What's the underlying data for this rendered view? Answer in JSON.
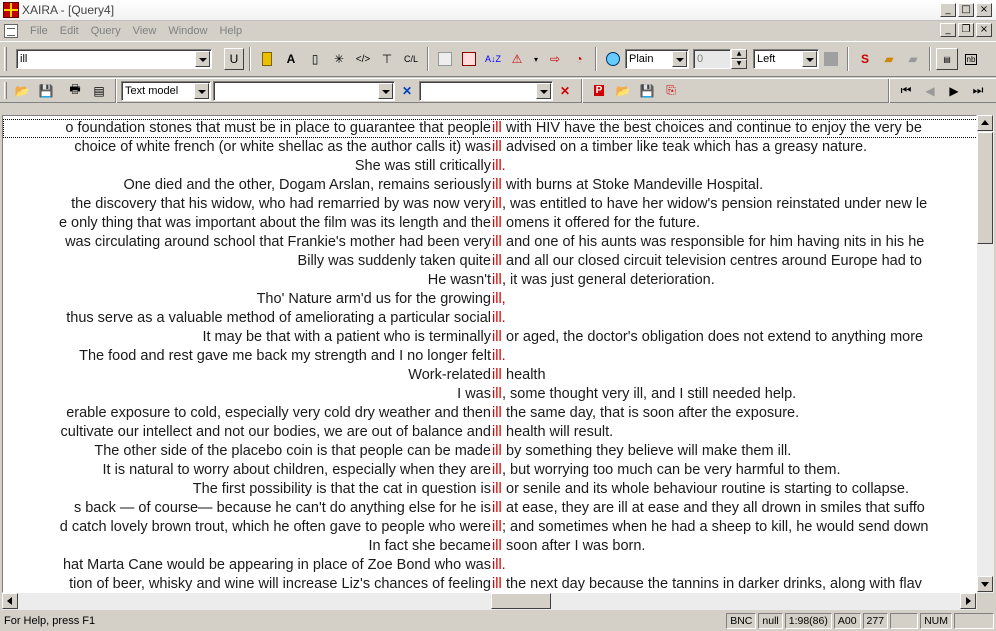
{
  "window": {
    "title": "XAIRA - [Query4]"
  },
  "menu": {
    "items": [
      "File",
      "Edit",
      "Query",
      "View",
      "Window",
      "Help"
    ]
  },
  "toolbar1": {
    "query_value": "ill",
    "u_button": "U",
    "style_value": "Plain",
    "size_value": "0",
    "align_value": "Left"
  },
  "toolbar2": {
    "model_value": "Text model",
    "filter1_value": "",
    "filter2_value": ""
  },
  "concordance": {
    "node_color": "#d00000",
    "rows": [
      {
        "left": "o foundation stones that must be in place to guarantee that people",
        "node": "ill",
        "right": "with HIV have the best choices and continue to enjoy the very be"
      },
      {
        "left": "choice of white french (or white shellac as the author calls it) was",
        "node": "ill",
        "right": "advised on a timber like teak which has a greasy nature."
      },
      {
        "left": "She was still critically",
        "node": "ill.",
        "right": ""
      },
      {
        "left": "One died and the other, Dogam Arslan, remains seriously",
        "node": "ill",
        "right": "with burns at Stoke Mandeville Hospital."
      },
      {
        "left": "the discovery that his widow, who had remarried by was now very",
        "node": "ill",
        "right": ", was entitled to have her widow's pension reinstated under new le"
      },
      {
        "left": "e only thing that was important about the film was its length and the",
        "node": "ill",
        "right": "omens it offered for the future."
      },
      {
        "left": "was circulating around school that Frankie's mother had been very",
        "node": "ill",
        "right": "and one of his aunts was responsible for him having nits in his he"
      },
      {
        "left": "Billy was suddenly taken quite",
        "node": "ill",
        "right": "and all our closed circuit television centres around Europe had to"
      },
      {
        "left": "He wasn't",
        "node": "ill",
        "right": ", it was just general deterioration."
      },
      {
        "left": "Tho' Nature arm'd us for the growing",
        "node": "ill,",
        "right": ""
      },
      {
        "left": "thus serve as a valuable method of ameliorating a particular social",
        "node": "ill.",
        "right": ""
      },
      {
        "left": "It may be that with a patient who is terminally",
        "node": "ill",
        "right": "or aged, the doctor's obligation does not extend to anything more"
      },
      {
        "left": "The food and rest gave me back my strength and I no longer felt",
        "node": "ill.",
        "right": ""
      },
      {
        "left": "Work-related",
        "node": "ill",
        "right": "health"
      },
      {
        "left": "I was",
        "node": "ill",
        "right": ", some thought very ill, and I still needed help."
      },
      {
        "left": "erable exposure to cold, especially very cold dry weather and then",
        "node": "ill",
        "right": "the same day, that is soon after the exposure."
      },
      {
        "left": "cultivate our intellect and not our bodies, we are out of balance and",
        "node": "ill",
        "right": "health will result."
      },
      {
        "left": "The other side of the placebo coin is that people can be made",
        "node": "ill",
        "right": "by something they believe will make them ill."
      },
      {
        "left": "It is natural to worry about children, especially when they are",
        "node": "ill",
        "right": ", but worrying too much can be very harmful to them."
      },
      {
        "left": "The first possibility is that the cat in question is",
        "node": "ill",
        "right": "or senile and its whole behaviour routine is starting to collapse."
      },
      {
        "left": "s back — of course— because he can't do anything else for he is",
        "node": "ill",
        "right": "at ease, they are ill at ease and they all drown in smiles that suffo"
      },
      {
        "left": "d catch lovely brown trout, which he often gave to people who were",
        "node": "ill",
        "right": "; and sometimes when he had a sheep to kill, he would send down"
      },
      {
        "left": "In fact she became",
        "node": "ill",
        "right": "soon after I was born."
      },
      {
        "left": "hat Marta Cane would be appearing in place of Zoe Bond who was",
        "node": "ill.",
        "right": ""
      },
      {
        "left": "tion of beer, whisky and wine will increase Liz's chances of feeling",
        "node": "ill",
        "right": "the next day because the tannins in darker drinks, along with flav"
      }
    ]
  },
  "status": {
    "help": "For Help, press F1",
    "cells": [
      "BNC",
      "null",
      "1:98(86)",
      "A00",
      "277",
      "",
      "NUM",
      ""
    ]
  }
}
